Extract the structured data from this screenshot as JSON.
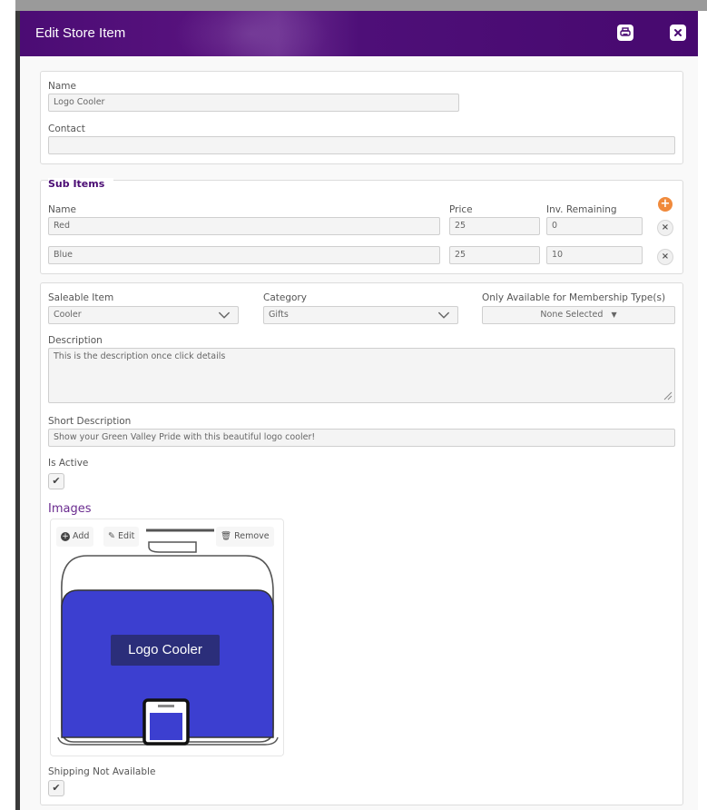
{
  "dialog": {
    "title": "Edit Store Item",
    "print_icon": "print-icon",
    "close_icon": "close-icon",
    "accent": "#4b0c74"
  },
  "basics": {
    "name_label": "Name",
    "name_value": "Logo Cooler",
    "contact_label": "Contact",
    "contact_value": ""
  },
  "sub_items": {
    "title": "Sub Items",
    "col_name": "Name",
    "col_price": "Price",
    "col_inv": "Inv. Remaining",
    "rows": [
      {
        "name": "Red",
        "price": "25",
        "inv": "0"
      },
      {
        "name": "Blue",
        "price": "25",
        "inv": "10"
      }
    ],
    "add_color": "#f08a3c"
  },
  "details": {
    "saleable_label": "Saleable Item",
    "saleable_value": "Cooler",
    "category_label": "Category",
    "category_value": "Gifts",
    "membership_label": "Only Available for Membership Type(s)",
    "membership_value": "None Selected",
    "description_label": "Description",
    "description_value": "This is the description once click details",
    "short_desc_label": "Short Description",
    "short_desc_value": "Show your Green Valley Pride with this beautiful logo cooler!",
    "is_active_label": "Is Active",
    "is_active_checked": true
  },
  "images": {
    "title": "Images",
    "add_label": "Add",
    "edit_label": "Edit",
    "remove_label": "Remove",
    "image_text": "Logo Cooler",
    "cooler_color": "#3c3fd0"
  },
  "shipping": {
    "label": "Shipping Not Available",
    "checked": true
  }
}
